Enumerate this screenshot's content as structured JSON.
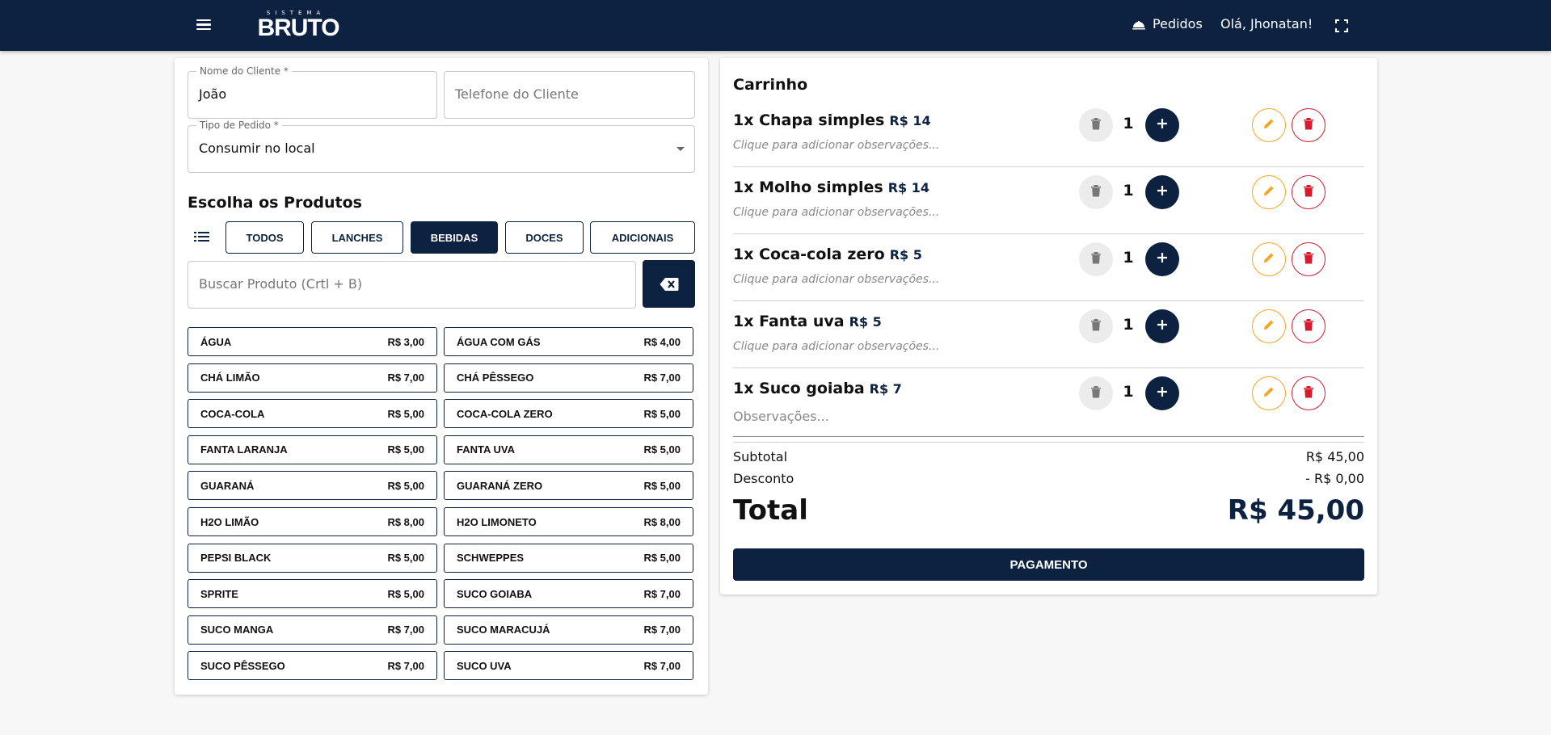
{
  "header": {
    "logo_small": "SISTEMA",
    "logo_big": "BRUTO",
    "orders_label": "Pedidos",
    "greeting": "Olá, Jhonatan!"
  },
  "form": {
    "client_name_label": "Nome do Cliente *",
    "client_name_value": "João",
    "client_phone_placeholder": "Telefone do Cliente",
    "order_type_label": "Tipo de Pedido *",
    "order_type_value": "Consumir no local"
  },
  "products_section": {
    "title": "Escolha os Produtos",
    "categories": [
      "TODOS",
      "LANCHES",
      "BEBIDAS",
      "DOCES",
      "ADICIONAIS"
    ],
    "active_category": "BEBIDAS",
    "search_placeholder": "Buscar Produto (Crtl + B)",
    "items": [
      {
        "name": "ÁGUA",
        "price": "R$ 3,00"
      },
      {
        "name": "ÁGUA COM GÁS",
        "price": "R$ 4,00"
      },
      {
        "name": "CHÁ LIMÃO",
        "price": "R$ 7,00"
      },
      {
        "name": "CHÁ PÊSSEGO",
        "price": "R$ 7,00"
      },
      {
        "name": "COCA-COLA",
        "price": "R$ 5,00"
      },
      {
        "name": "COCA-COLA ZERO",
        "price": "R$ 5,00"
      },
      {
        "name": "FANTA LARANJA",
        "price": "R$ 5,00"
      },
      {
        "name": "FANTA UVA",
        "price": "R$ 5,00"
      },
      {
        "name": "GUARANÁ",
        "price": "R$ 5,00"
      },
      {
        "name": "GUARANÁ ZERO",
        "price": "R$ 5,00"
      },
      {
        "name": "H2O LIMÃO",
        "price": "R$ 8,00"
      },
      {
        "name": "H2O LIMONETO",
        "price": "R$ 8,00"
      },
      {
        "name": "PEPSI BLACK",
        "price": "R$ 5,00"
      },
      {
        "name": "SCHWEPPES",
        "price": "R$ 5,00"
      },
      {
        "name": "SPRITE",
        "price": "R$ 5,00"
      },
      {
        "name": "SUCO GOIABA",
        "price": "R$ 7,00"
      },
      {
        "name": "SUCO MANGA",
        "price": "R$ 7,00"
      },
      {
        "name": "SUCO MARACUJÁ",
        "price": "R$ 7,00"
      },
      {
        "name": "SUCO PÊSSEGO",
        "price": "R$ 7,00"
      },
      {
        "name": "SUCO UVA",
        "price": "R$ 7,00"
      }
    ]
  },
  "cart": {
    "title": "Carrinho",
    "items": [
      {
        "name": "1x Chapa simples",
        "price": "R$ 14",
        "qty": "1",
        "obs": "Clique para adicionar observações..."
      },
      {
        "name": "1x Molho simples",
        "price": "R$ 14",
        "qty": "1",
        "obs": "Clique para adicionar observações..."
      },
      {
        "name": "1x Coca-cola zero",
        "price": "R$ 5",
        "qty": "1",
        "obs": "Clique para adicionar observações..."
      },
      {
        "name": "1x Fanta uva",
        "price": "R$ 5",
        "qty": "1",
        "obs": "Clique para adicionar observações..."
      },
      {
        "name": "1x Suco goiaba",
        "price": "R$ 7",
        "qty": "1",
        "obs_placeholder": "Observações..."
      }
    ],
    "subtotal_label": "Subtotal",
    "subtotal_value": "R$ 45,00",
    "discount_label": "Desconto",
    "discount_value": "- R$ 0,00",
    "total_label": "Total",
    "total_value": "R$ 45,00",
    "pay_label": "PAGAMENTO"
  },
  "colors": {
    "brand": "#0d2240",
    "edit": "#f5a623",
    "delete": "#d81b2c"
  },
  "icons": [
    "menu-icon",
    "cloche-icon",
    "fullscreen-icon",
    "list-icon",
    "backspace-icon",
    "trash-icon",
    "plus-icon",
    "pencil-icon",
    "delete-icon"
  ]
}
